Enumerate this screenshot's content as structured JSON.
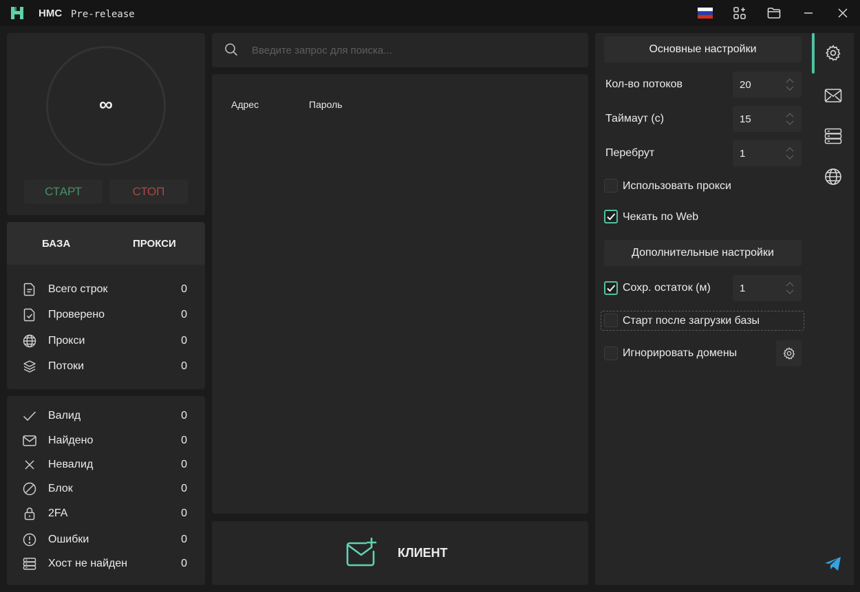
{
  "app": {
    "name": "HMC",
    "tag": "Pre-release"
  },
  "titlebar": {
    "icons": [
      "russia-flag-icon",
      "add-module-icon",
      "folder-icon",
      "minimize-icon",
      "close-icon"
    ]
  },
  "counter": {
    "value": "∞"
  },
  "controls": {
    "start_label": "СТАРТ",
    "stop_label": "СТОП"
  },
  "tabs": [
    {
      "label": "БАЗА"
    },
    {
      "label": "ПРОКСИ"
    }
  ],
  "stats_top": [
    {
      "icon": "document-icon",
      "label": "Всего строк",
      "value": "0"
    },
    {
      "icon": "document-check-icon",
      "label": "Проверено",
      "value": "0"
    },
    {
      "icon": "globe-icon",
      "label": "Прокси",
      "value": "0"
    },
    {
      "icon": "layers-icon",
      "label": "Потоки",
      "value": "0"
    }
  ],
  "stats_bottom": [
    {
      "icon": "check-icon",
      "label": "Валид",
      "value": "0"
    },
    {
      "icon": "mail-icon",
      "label": "Найдено",
      "value": "0"
    },
    {
      "icon": "x-icon",
      "label": "Невалид",
      "value": "0"
    },
    {
      "icon": "block-icon",
      "label": "Блок",
      "value": "0"
    },
    {
      "icon": "lock-icon",
      "label": "2FA",
      "value": "0"
    },
    {
      "icon": "alert-icon",
      "label": "Ошибки",
      "value": "0"
    },
    {
      "icon": "server-icon",
      "label": "Хост не найден",
      "value": "0"
    }
  ],
  "search": {
    "placeholder": "Введите запрос для поиска..."
  },
  "table": {
    "columns": [
      "Адрес",
      "Пароль"
    ]
  },
  "client_button": {
    "label": "КЛИЕНТ"
  },
  "settings": {
    "main_header": "Основные настройки",
    "threads": {
      "label": "Кол-во потоков",
      "value": "20"
    },
    "timeout": {
      "label": "Таймаут (с)",
      "value": "15"
    },
    "rebrute": {
      "label": "Перебрут",
      "value": "1"
    },
    "use_proxy": {
      "label": "Использовать прокси",
      "checked": false
    },
    "check_web": {
      "label": "Чекать по Web",
      "checked": true
    },
    "extra_header": "Дополнительные настройки",
    "save_rest": {
      "label": "Сохр. остаток (м)",
      "checked": true,
      "value": "1"
    },
    "start_after_load": {
      "label": "Старт после загрузки базы",
      "checked": false
    },
    "ignore_domains": {
      "label": "Игнорировать домены",
      "checked": false
    }
  },
  "sidebar": {
    "icons": [
      "settings-icon",
      "mail-icon",
      "database-icon",
      "globe-icon",
      "telegram-icon"
    ],
    "active": "settings-icon"
  },
  "colors": {
    "accent": "#4fc3a1",
    "start": "#4b8f6a",
    "stop": "#a84943",
    "panel": "#262626",
    "background": "#1b1b1b"
  }
}
